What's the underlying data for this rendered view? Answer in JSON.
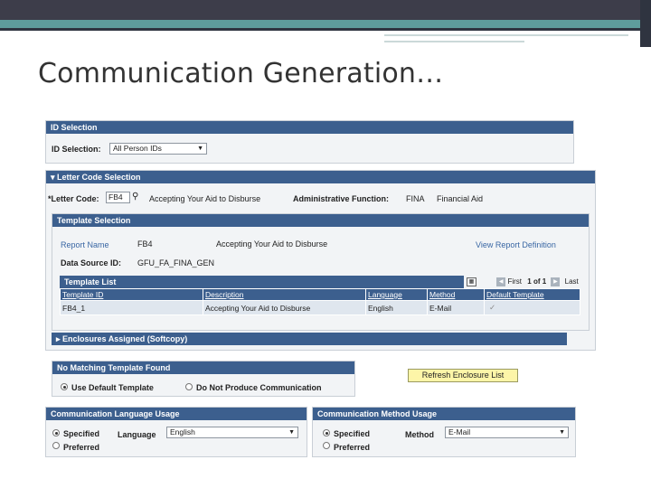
{
  "slide_title": "Communication Generation…",
  "id_selection": {
    "header": "ID Selection",
    "label": "ID Selection:",
    "value": "All Person IDs"
  },
  "letter_code": {
    "header": "Letter Code Selection",
    "label": "*Letter Code:",
    "value": "FB4",
    "description": "Accepting Your Aid to Disburse",
    "admin_label": "Administrative Function:",
    "admin_code": "FINA",
    "admin_desc": "Financial Aid"
  },
  "template_selection": {
    "header": "Template Selection",
    "report_name_label": "Report Name",
    "report_name": "FB4",
    "report_desc": "Accepting Your Aid to Disburse",
    "view_link": "View Report Definition",
    "data_source_label": "Data Source ID:",
    "data_source": "GFU_FA_FINA_GEN"
  },
  "template_list": {
    "header": "Template List",
    "nav_first": "First",
    "nav_count": "1 of 1",
    "nav_last": "Last",
    "columns": [
      "Template ID",
      "Description",
      "Language",
      "Method",
      "Default Template"
    ],
    "row": {
      "id": "FB4_1",
      "description": "Accepting Your Aid to Disburse",
      "language": "English",
      "method": "E-Mail",
      "default": "✓"
    }
  },
  "enclosures": {
    "header": "Enclosures Assigned (Softcopy)"
  },
  "no_match": {
    "header": "No Matching Template Found",
    "opt_default": "Use Default Template",
    "opt_none": "Do Not Produce Communication"
  },
  "refresh_button": "Refresh Enclosure List",
  "language_usage": {
    "header": "Communication Language Usage",
    "specified": "Specified",
    "preferred": "Preferred",
    "label": "Language",
    "value": "English"
  },
  "method_usage": {
    "header": "Communication Method Usage",
    "specified": "Specified",
    "preferred": "Preferred",
    "label": "Method",
    "value": "E-Mail"
  },
  "colors": {
    "header_blue": "#3c5f8e",
    "teal": "#5e9c9c",
    "button_yellow": "#fdf5a8"
  }
}
